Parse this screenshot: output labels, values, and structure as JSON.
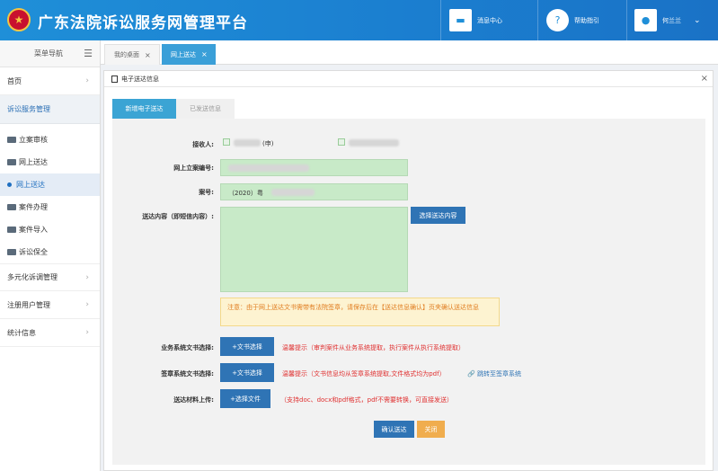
{
  "header": {
    "title": "广东法院诉讼服务网管理平台",
    "messages_label": "消息中心",
    "help_label": "帮助指引",
    "user_name": "何兰兰"
  },
  "sidebar": {
    "head_label": "菜单导航",
    "home_label": "首页",
    "group_label": "诉讼服务管理",
    "subitems": [
      "立案审核",
      "网上送达",
      "网上送达",
      "案件办理",
      "案件导入",
      "诉讼保全"
    ],
    "bottom_items": [
      "多元化诉调管理",
      "注册用户管理",
      "统计信息"
    ]
  },
  "tabs": [
    {
      "label": "我的桌面",
      "active": false
    },
    {
      "label": "网上送达",
      "active": true
    }
  ],
  "panel": {
    "title": "电子送达信息",
    "subtabs": [
      "新增电子送达",
      "已发送信息"
    ]
  },
  "form": {
    "receiver_label": "接收人:",
    "receiver_1_suffix": "(申)",
    "case_no_online_label": "网上立案编号:",
    "case_no_label": "案号:",
    "case_no_value": "（2020）粤",
    "content_label": "送达内容（即短信内容）:",
    "choose_content_button": "选择送达内容",
    "notice": "注意：由于网上送达文书需带有法院签章，请保存后在【送达信息确认】页夹确认送达信息",
    "business_doc_label": "业务系统文书选择:",
    "business_doc_button": "+文书选择",
    "business_doc_hint": "温馨提示（审判案件从业务系统提取，执行案件从执行系统提取）",
    "seal_doc_label": "签章系统文书选择:",
    "seal_doc_button": "+文书选择",
    "seal_doc_hint": "温馨提示（文书信息均从签章系统提取,文件格式均为pdf）",
    "seal_link": "跳转至签章系统",
    "upload_label": "送达材料上传:",
    "upload_button": "+选择文件",
    "upload_hint": "（支持doc、docx和pdf格式，pdf不需要转换，可直接发送）",
    "confirm_button": "确认送达",
    "close_button": "关闭"
  }
}
